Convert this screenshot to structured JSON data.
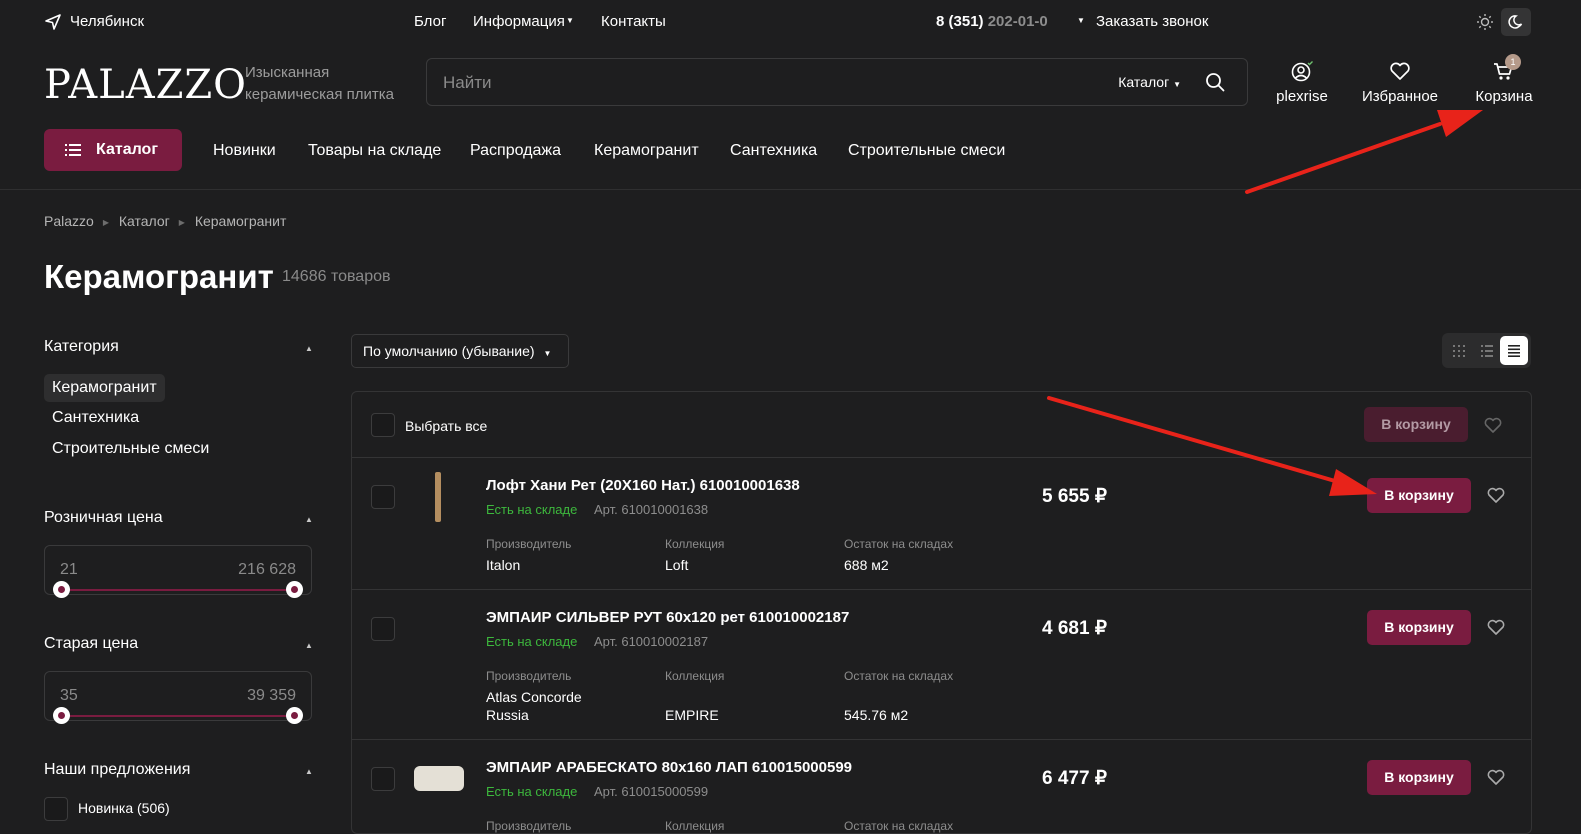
{
  "topbar": {
    "city": "Челябинск",
    "links": [
      "Блог",
      "Информация",
      "Контакты"
    ],
    "phone_main": "8 (351)",
    "phone_rest": "202-01-0",
    "callback": "Заказать звонок"
  },
  "header": {
    "logo": "PALAZZO",
    "tagline_1": "Изысканная",
    "tagline_2": "керамическая плитка",
    "search_placeholder": "Найти",
    "search_catalog": "Каталог",
    "user_label": "plexrise",
    "favorites_label": "Избранное",
    "cart_label": "Корзина",
    "cart_count": "1"
  },
  "nav": {
    "catalog_button": "Каталог",
    "links": [
      "Новинки",
      "Товары на складе",
      "Распродажа",
      "Керамогранит",
      "Сантехника",
      "Строительные смеси"
    ]
  },
  "breadcrumb": [
    "Palazzo",
    "Каталог",
    "Керамогранит"
  ],
  "page": {
    "title": "Керамогранит",
    "count": "14686 товаров",
    "sort_label": "По умолчанию (убывание)"
  },
  "filters": {
    "category_title": "Категория",
    "categories": [
      "Керамогранит",
      "Сантехника",
      "Строительные смеси"
    ],
    "retail_title": "Розничная цена",
    "retail_min": "21",
    "retail_max": "216 628",
    "old_title": "Старая цена",
    "old_min": "35",
    "old_max": "39 359",
    "offers_title": "Наши предложения",
    "offer_new": "Новинка (506)"
  },
  "list": {
    "select_all": "Выбрать все",
    "bulk_cart": "В корзину",
    "labels": {
      "maker": "Производитель",
      "collection": "Коллекция",
      "stock_rest": "Остаток на складах"
    },
    "products": [
      {
        "name": "Лофт Хани Рет (20X160 Нат.) 610010001638",
        "stock": "Есть на складе",
        "article": "Арт. 610010001638",
        "maker": "Italon",
        "maker_2": "",
        "collection": "Loft",
        "rest": "688 м2",
        "price": "5 655 ₽",
        "cart": "В корзину"
      },
      {
        "name": "ЭМПАИР СИЛЬВЕР РУТ 60х120 рет 610010002187",
        "stock": "Есть на складе",
        "article": "Арт. 610010002187",
        "maker": "Atlas Concorde",
        "maker_2": "Russia",
        "collection": "EMPIRE",
        "rest": "545.76 м2",
        "price": "4 681 ₽",
        "cart": "В корзину"
      },
      {
        "name": "ЭМПАИР АРАБЕСКАТО 80х160 ЛАП 610015000599",
        "stock": "Есть на складе",
        "article": "Арт. 610015000599",
        "price": "6 477 ₽",
        "cart": "В корзину"
      }
    ]
  },
  "colors": {
    "background": "#1e1e1f",
    "accent": "#7a1c40",
    "in_stock": "#3db83d",
    "annotation_arrow": "#e8231a"
  }
}
